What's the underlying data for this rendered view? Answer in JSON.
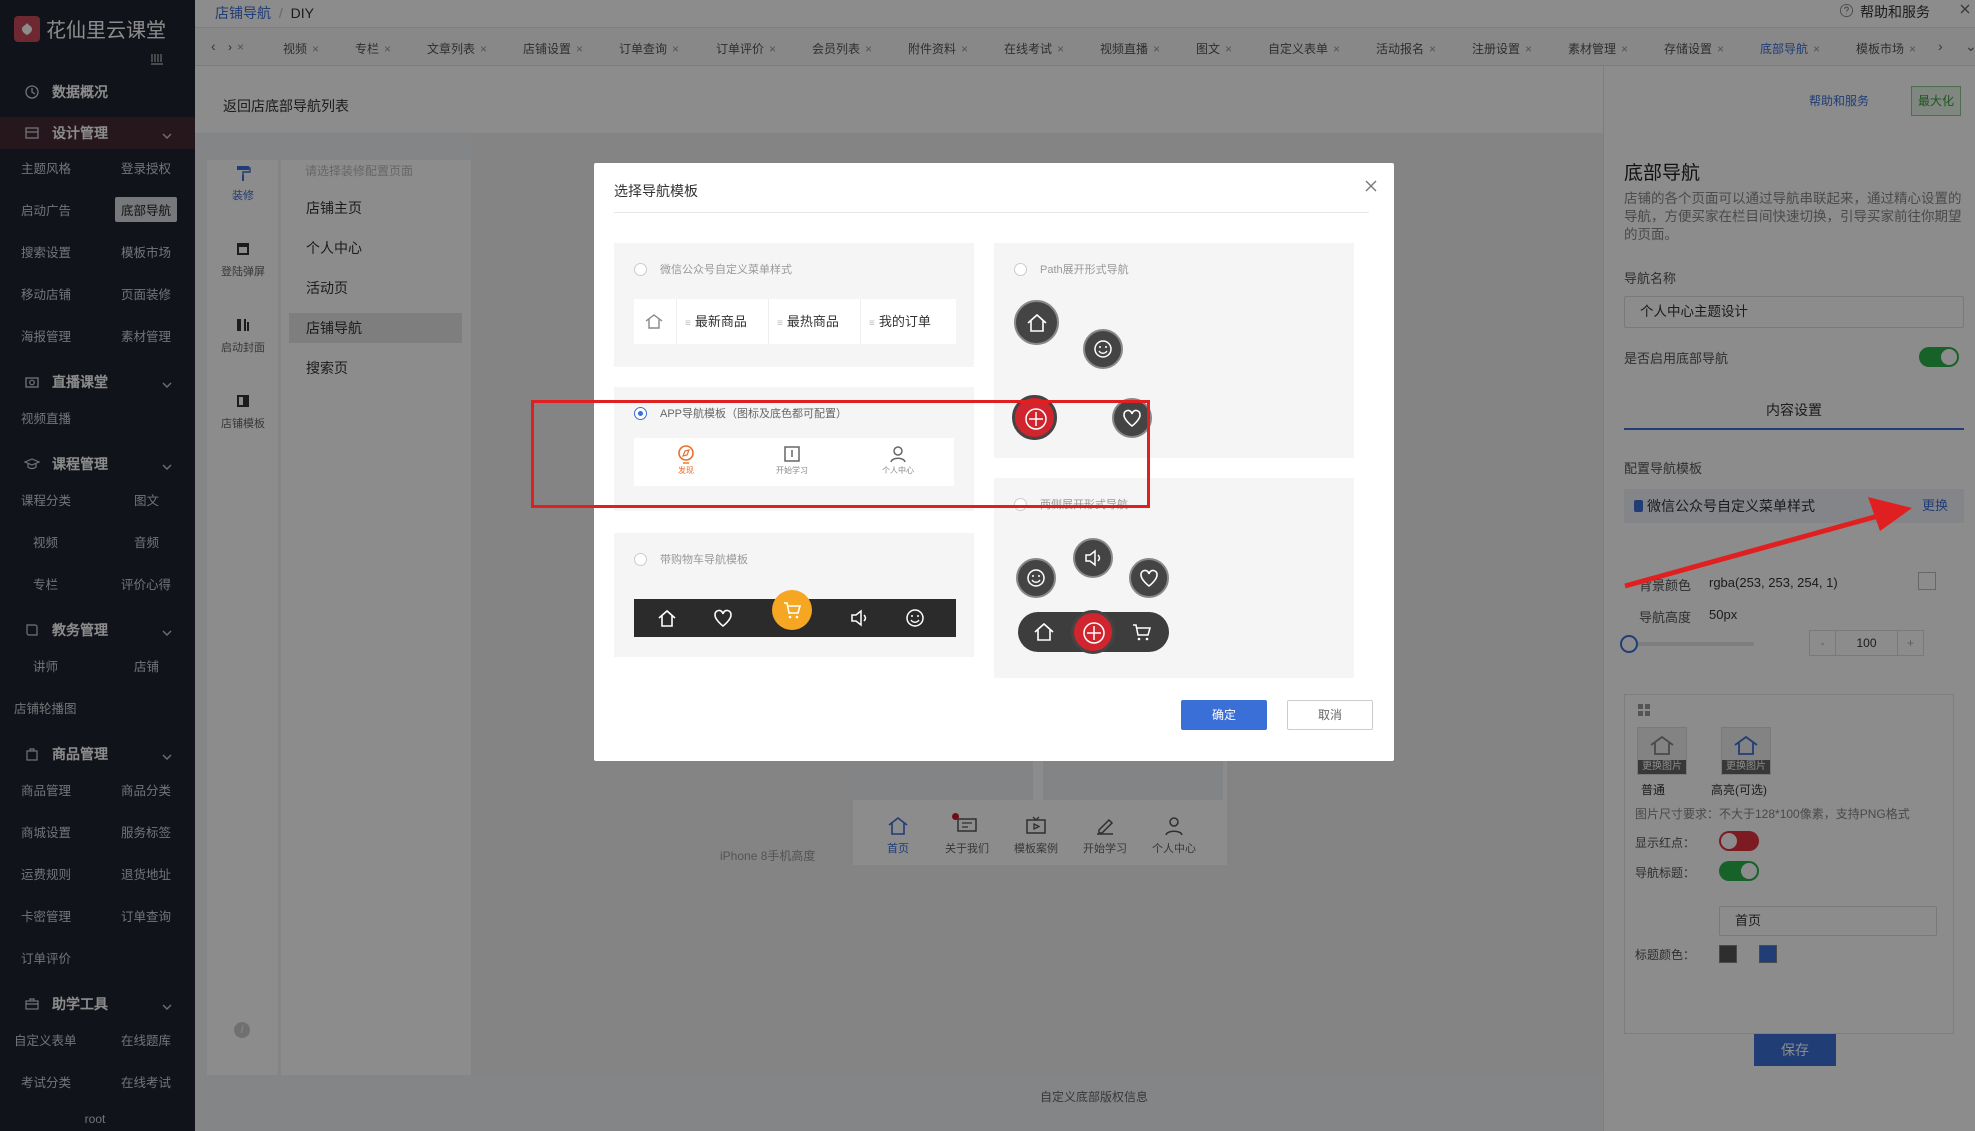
{
  "brand": {
    "name": "花仙里云课堂"
  },
  "sidebar": {
    "sections": [
      {
        "label": "数据概况",
        "icon": "clock-icon"
      },
      {
        "label": "设计管理",
        "icon": "layout-icon"
      },
      {
        "label": "直播课堂",
        "icon": "camera-icon"
      },
      {
        "label": "课程管理",
        "icon": "graduation-cap-icon"
      },
      {
        "label": "教务管理",
        "icon": "book-icon"
      },
      {
        "label": "商品管理",
        "icon": "bag-icon"
      },
      {
        "label": "助学工具",
        "icon": "toolbox-icon"
      }
    ],
    "items": [
      "主题风格",
      "登录授权",
      "启动广告",
      "底部导航",
      "搜索设置",
      "模板市场",
      "移动店铺",
      "页面装修",
      "海报管理",
      "素材管理",
      "视频直播",
      "课程分类",
      "图文",
      "视频",
      "音频",
      "专栏",
      "评价心得",
      "讲师",
      "店铺",
      "店铺轮播图",
      "商品管理",
      "商品分类",
      "商城设置",
      "服务标签",
      "运费规则",
      "退货地址",
      "卡密管理",
      "订单查询",
      "订单评价",
      "自定义表单",
      "在线题库",
      "考试分类",
      "在线考试"
    ],
    "footer": "root"
  },
  "breadcrumb": {
    "parent": "店铺导航",
    "sep": "/",
    "current": "DIY"
  },
  "help": "帮助和服务",
  "tabs": [
    "视频",
    "专栏",
    "文章列表",
    "店铺设置",
    "订单查询",
    "订单评价",
    "会员列表",
    "附件资料",
    "在线考试",
    "视频直播",
    "图文",
    "自定义表单",
    "活动报名",
    "注册设置",
    "素材管理",
    "存储设置",
    "底部导航",
    "模板市场"
  ],
  "content": {
    "back_title": "返回店底部导航列表"
  },
  "tools": [
    "装修",
    "登陆弹屏",
    "启动封面",
    "店铺模板"
  ],
  "pages": {
    "placeholder": "请选择装修配置页面",
    "items": [
      "店铺主页",
      "个人中心",
      "活动页",
      "店铺导航",
      "搜索页"
    ]
  },
  "preview": {
    "nav": [
      "首页",
      "关于我们",
      "模板案例",
      "开始学习",
      "个人中心"
    ],
    "device_label": "iPhone 8手机高度",
    "footer": "自定义底部版权信息"
  },
  "right": {
    "help_link": "帮助和服务",
    "max_btn": "最大化",
    "title": "底部导航",
    "desc": "店铺的各个页面可以通过导航串联起来，通过精心设置的导航，方便买家在栏目间快速切换，引导买家前往你期望的页面。",
    "name_label": "导航名称",
    "name_value": "个人中心主题设计",
    "enable_label": "是否启用底部导航",
    "tab": "内容设置",
    "tpl_label": "配置导航模板",
    "tpl_value": "微信公众号自定义菜单样式",
    "tpl_change": "更换",
    "bg_label": "背景颜色",
    "bg_value": "rgba(253, 253, 254, 1)",
    "height_label": "导航高度",
    "height_value": "50px",
    "stepper_value": "100",
    "slider_level": 0.0,
    "img_normal_cap": "更换图片",
    "img_normal_label": "普通",
    "img_high_cap": "更换图片",
    "img_high_label": "高亮(可选)",
    "img_req": "图片尺寸要求：不大于128*100像素，支持PNG格式",
    "dot_label": "显示红点：",
    "title_label": "导航标题：",
    "title_value": "首页",
    "color_label": "标题颜色：",
    "save": "保存"
  },
  "dialog": {
    "title": "选择导航模板",
    "options": [
      {
        "label": "微信公众号自定义菜单样式",
        "selected": false
      },
      {
        "label": "APP导航模板（图标及底色都可配置）",
        "selected": true
      },
      {
        "label": "带购物车导航模板",
        "selected": false
      },
      {
        "label": "Path展开形式导航",
        "selected": false
      },
      {
        "label": "两侧展开形式导航",
        "selected": false
      }
    ],
    "wx_items": [
      "最新商品",
      "最热商品",
      "我的订单"
    ],
    "app_items": [
      "发现",
      "开始学习",
      "个人中心"
    ],
    "ok": "确定",
    "cancel": "取消"
  },
  "colors": {
    "accent": "#3b6fd8",
    "annotation": "#e02020",
    "toggle_on": "#2bb34a",
    "toggle_off": "#e2323e"
  }
}
